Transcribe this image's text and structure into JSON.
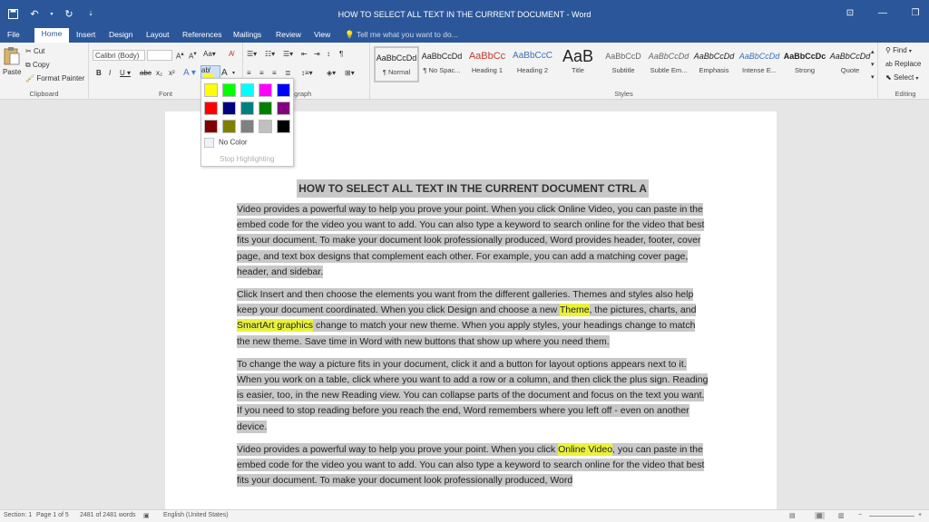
{
  "window": {
    "title": "HOW TO SELECT ALL TEXT IN THE CURRENT DOCUMENT - Word"
  },
  "tabs": [
    {
      "label": "File"
    },
    {
      "label": "Home"
    },
    {
      "label": "Insert"
    },
    {
      "label": "Design"
    },
    {
      "label": "Layout"
    },
    {
      "label": "References"
    },
    {
      "label": "Mailings"
    },
    {
      "label": "Review"
    },
    {
      "label": "View"
    }
  ],
  "tell_me": "Tell me what you want to do...",
  "clipboard": {
    "paste": "Paste",
    "cut": "Cut",
    "copy": "Copy",
    "format_painter": "Format Painter",
    "label": "Clipboard"
  },
  "font": {
    "name": "Calibri (Body)",
    "size": "",
    "label": "Font"
  },
  "paragraph": {
    "label": "agraph"
  },
  "styles": {
    "label": "Styles",
    "items": [
      {
        "sample": "AaBbCcDd",
        "name": "¶ Normal"
      },
      {
        "sample": "AaBbCcDd",
        "name": "¶ No Spac..."
      },
      {
        "sample": "AaBbCc",
        "name": "Heading 1"
      },
      {
        "sample": "AaBbCcC",
        "name": "Heading 2"
      },
      {
        "sample": "AaB",
        "name": "Title"
      },
      {
        "sample": "AaBbCcD",
        "name": "Subtitle"
      },
      {
        "sample": "AaBbCcDd",
        "name": "Subtle Em..."
      },
      {
        "sample": "AaBbCcDd",
        "name": "Emphasis"
      },
      {
        "sample": "AaBbCcDd",
        "name": "Intense E..."
      },
      {
        "sample": "AaBbCcDc",
        "name": "Strong"
      },
      {
        "sample": "AaBbCcDd",
        "name": "Quote"
      }
    ]
  },
  "editing": {
    "find": "Find",
    "replace": "Replace",
    "select": "Select",
    "label": "Editing"
  },
  "highlight_menu": {
    "colors": [
      "#ffff00",
      "#00ff00",
      "#00ffff",
      "#ff00ff",
      "#0000ff",
      "#ff0000",
      "#000080",
      "#008080",
      "#008000",
      "#800080",
      "#800000",
      "#808000",
      "#808080",
      "#c0c0c0",
      "#000000"
    ],
    "no_color": "No Color",
    "stop": "Stop Highlighting"
  },
  "document": {
    "title": "HOW TO SELECT ALL TEXT IN THE CURRENT DOCUMENT CTRL A",
    "p1": "Video provides a powerful way to help you prove your point. When you click Online Video, you can paste in the embed code for the video you want to add. You can also type a keyword to search online for the video that best fits your document. To make your document look professionally produced, Word provides header, footer, cover page, and text box designs that complement each other. For example, you can add a matching cover page, header, and sidebar.",
    "p2a": "Click Insert and then choose the elements you want from the different galleries. Themes and styles also help keep your document coordinated. When you click Design and choose a new ",
    "p2_hl1": "Theme",
    "p2b": ", the pictures, charts, and ",
    "p2_hl2": "SmartArt graphics",
    "p2c": " change to match your new theme. When you apply styles, your headings change to match the new theme. Save time in Word with new buttons that show up where you need them.",
    "p3": "To change the way a picture fits in your document, click it and a button for layout options appears next to it. When you work on a table, click where you want to add a row or a column, and then click the plus sign. Reading is easier, too, in the new Reading view. You can collapse parts of the document and focus on the text you want. If you need to stop reading before you reach the end, Word remembers where you left off - even on another device.",
    "p4a": "Video provides a powerful way to help you prove your point. When you click ",
    "p4_hl": "Online Video",
    "p4b": ", you can paste in the embed code for the video you want to add. You can also type a keyword to search online for the video that best fits your document. To make your document look professionally produced, Word"
  },
  "status": {
    "section": "Section: 1",
    "page": "Page 1 of 5",
    "words": "2481 of 2481 words",
    "language": "English (United States)"
  }
}
